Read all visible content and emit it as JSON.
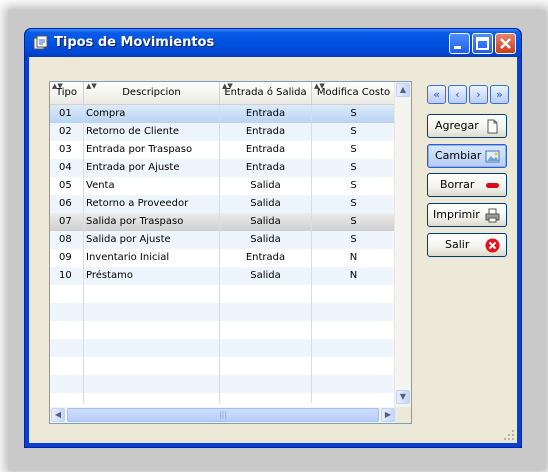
{
  "window": {
    "title": "Tipos de Movimientos"
  },
  "grid": {
    "columns": [
      "Tipo",
      "Descripcion",
      "Entrada ó Salida",
      "Modifica Costo"
    ],
    "rows": [
      [
        "01",
        "Compra",
        "Entrada",
        "S"
      ],
      [
        "02",
        "Retorno de Cliente",
        "Entrada",
        "S"
      ],
      [
        "03",
        "Entrada por Traspaso",
        "Entrada",
        "S"
      ],
      [
        "04",
        "Entrada por Ajuste",
        "Entrada",
        "S"
      ],
      [
        "05",
        "Venta",
        "Salida",
        "S"
      ],
      [
        "06",
        "Retorno a  Proveedor",
        "Salida",
        "S"
      ],
      [
        "07",
        "Salida por Traspaso",
        "Salida",
        "S"
      ],
      [
        "08",
        "Salida por Ajuste",
        "Salida",
        "S"
      ],
      [
        "09",
        "Inventario Inicial",
        "Entrada",
        "N"
      ],
      [
        "10",
        "Préstamo",
        "Salida",
        "N"
      ]
    ],
    "selected_row": 0,
    "hover_row": 6
  },
  "actions": {
    "agregar": "Agregar",
    "cambiar": "Cambiar",
    "borrar": "Borrar",
    "imprimir": "Imprimir",
    "salir": "Salir"
  },
  "nav_icons": [
    "first-icon",
    "prev-icon",
    "next-icon",
    "last-icon"
  ],
  "colors": {
    "titlebar": "#0050e0",
    "selected_row": "#c6dcf3",
    "hover_row": "#dcdcdc",
    "alt_row": "#eef5fc"
  }
}
